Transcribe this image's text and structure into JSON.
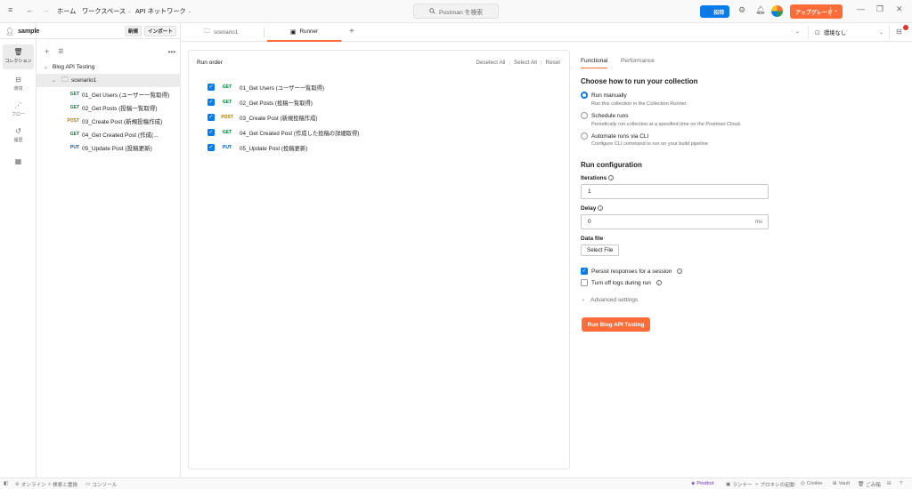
{
  "topbar": {
    "home": "ホーム",
    "workspaces": "ワークスペース",
    "api_network": "API ネットワーク",
    "search_placeholder": "Postman を検索",
    "invite": "招待",
    "upgrade": "アップグレード"
  },
  "rail": {
    "items": [
      {
        "label": "コレクション",
        "icon": "collections-icon"
      },
      {
        "label": "環境",
        "icon": "environments-icon"
      },
      {
        "label": "フロー",
        "icon": "flows-icon"
      },
      {
        "label": "履歴",
        "icon": "history-icon"
      },
      {
        "label": "",
        "icon": "grid-icon"
      }
    ]
  },
  "sidebar": {
    "workspace": "sample",
    "new": "新規",
    "import": "インポート",
    "collection": "Blog API Testing",
    "folder": "scenario1",
    "requests": [
      {
        "method": "GET",
        "name": "01_Get Users (ユーザー一覧取得)"
      },
      {
        "method": "GET",
        "name": "02_Get Posts (投稿一覧取得)"
      },
      {
        "method": "POST",
        "name": "03_Create Post (新規投稿作成)"
      },
      {
        "method": "GET",
        "name": "04_Get Created Post (作成(..."
      },
      {
        "method": "PUT",
        "name": "05_Update Post (投稿更新)"
      }
    ]
  },
  "tabs": {
    "items": [
      "scenario1",
      "Runner"
    ],
    "environment": "環境なし"
  },
  "run_order": {
    "title": "Run order",
    "deselect_all": "Deselect All",
    "select_all": "Select All",
    "reset": "Reset",
    "rows": [
      {
        "method": "GET",
        "name": "01_Get Users (ユーザー一覧取得)"
      },
      {
        "method": "GET",
        "name": "02_Get Posts (投稿一覧取得)"
      },
      {
        "method": "POST",
        "name": "03_Create Post (新規投稿作成)"
      },
      {
        "method": "GET",
        "name": "04_Get Created Post (作成した投稿の詳細取得)"
      },
      {
        "method": "PUT",
        "name": "05_Update Post (投稿更新)"
      }
    ]
  },
  "config": {
    "tab_functional": "Functional",
    "tab_performance": "Performance",
    "choose_title": "Choose how to run your collection",
    "options": [
      {
        "title": "Run manually",
        "desc": "Run this collection in the Collection Runner."
      },
      {
        "title": "Schedule runs",
        "desc": "Periodically run collection at a specified time on the Postman Cloud."
      },
      {
        "title": "Automate runs via CLI",
        "desc": "Configure CLI command to run on your build pipeline."
      }
    ],
    "run_config_title": "Run configuration",
    "iterations_label": "Iterations",
    "iterations_value": "1",
    "delay_label": "Delay",
    "delay_value": "0",
    "delay_unit": "ms",
    "data_file_label": "Data file",
    "select_file": "Select File",
    "persist": "Persist responses for a session",
    "turn_off_logs": "Turn off logs during run",
    "advanced": "Advanced settings",
    "run_button": "Run Blog API Testing"
  },
  "statusbar": {
    "online": "オンライン",
    "find_replace": "検索と置換",
    "console": "コンソール",
    "postbot": "Postbot",
    "runner": "ランナー",
    "proxy": "プロキシの起動",
    "cookie": "Cookie",
    "vault": "Vault",
    "trash": "ごみ箱"
  }
}
